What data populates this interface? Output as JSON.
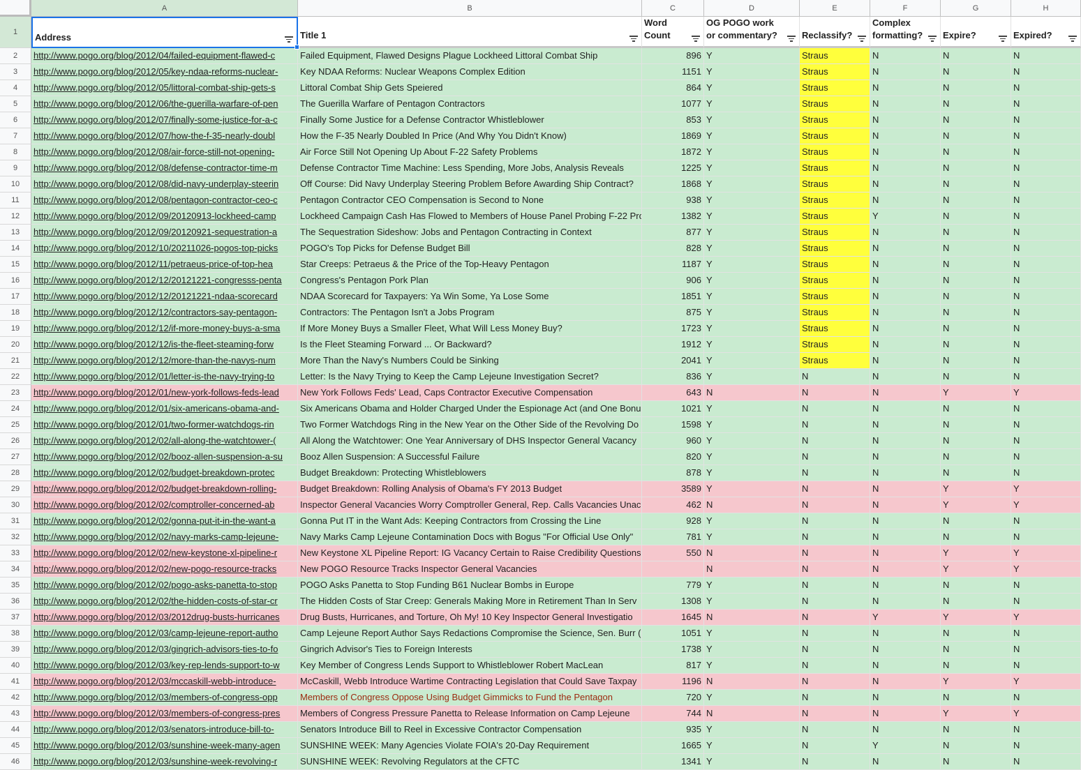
{
  "columns": [
    "A",
    "B",
    "C",
    "D",
    "E",
    "F",
    "G",
    "H"
  ],
  "headers": [
    "Address",
    "Title 1",
    "Word Count",
    "OG POGO work or commentary?",
    "Reclassify?",
    "Complex formatting?",
    "Expire?",
    "Expired?"
  ],
  "colors": {
    "green": "#c9ebd0",
    "pink": "#f6c7cd",
    "yellow": "#ffff3c",
    "dark_red_text": "#9c2a10"
  },
  "rows": [
    [
      "http://www.pogo.org/blog/2012/04/failed-equipment-flawed-c",
      "Failed Equipment, Flawed Designs Plague Lockheed Littoral Combat Ship",
      "896",
      "Y",
      "Straus",
      "N",
      "N",
      "N",
      "green"
    ],
    [
      "http://www.pogo.org/blog/2012/05/key-ndaa-reforms-nuclear-",
      "Key NDAA Reforms: Nuclear Weapons Complex Edition",
      "1151",
      "Y",
      "Straus",
      "N",
      "N",
      "N",
      "green"
    ],
    [
      "http://www.pogo.org/blog/2012/05/littoral-combat-ship-gets-s",
      "Littoral Combat Ship Gets Speiered",
      "864",
      "Y",
      "Straus",
      "N",
      "N",
      "N",
      "green"
    ],
    [
      "http://www.pogo.org/blog/2012/06/the-guerilla-warfare-of-pen",
      "The Guerilla Warfare of Pentagon Contractors",
      "1077",
      "Y",
      "Straus",
      "N",
      "N",
      "N",
      "green"
    ],
    [
      "http://www.pogo.org/blog/2012/07/finally-some-justice-for-a-c",
      "Finally Some Justice for a Defense Contractor Whistleblower",
      "853",
      "Y",
      "Straus",
      "N",
      "N",
      "N",
      "green"
    ],
    [
      "http://www.pogo.org/blog/2012/07/how-the-f-35-nearly-doubl",
      "How the F-35 Nearly Doubled In Price (And Why You Didn't Know)",
      "1869",
      "Y",
      "Straus",
      "N",
      "N",
      "N",
      "green"
    ],
    [
      "http://www.pogo.org/blog/2012/08/air-force-still-not-opening-",
      "Air Force Still Not Opening Up About F-22 Safety Problems",
      "1872",
      "Y",
      "Straus",
      "N",
      "N",
      "N",
      "green"
    ],
    [
      "http://www.pogo.org/blog/2012/08/defense-contractor-time-m",
      "Defense Contractor Time Machine: Less Spending, More Jobs, Analysis Reveals",
      "1225",
      "Y",
      "Straus",
      "N",
      "N",
      "N",
      "green"
    ],
    [
      "http://www.pogo.org/blog/2012/08/did-navy-underplay-steerin",
      "Off Course: Did Navy Underplay Steering Problem Before Awarding Ship Contract?",
      "1868",
      "Y",
      "Straus",
      "N",
      "N",
      "N",
      "green"
    ],
    [
      "http://www.pogo.org/blog/2012/08/pentagon-contractor-ceo-c",
      "Pentagon Contractor CEO Compensation is Second to None",
      "938",
      "Y",
      "Straus",
      "N",
      "N",
      "N",
      "green"
    ],
    [
      "http://www.pogo.org/blog/2012/09/20120913-lockheed-camp",
      "Lockheed Campaign Cash Has Flowed to Members of House Panel Probing F-22 Pro",
      "1382",
      "Y",
      "Straus",
      "Y",
      "N",
      "N",
      "green"
    ],
    [
      "http://www.pogo.org/blog/2012/09/20120921-sequestration-a",
      "The Sequestration Sideshow: Jobs and Pentagon Contracting in Context",
      "877",
      "Y",
      "Straus",
      "N",
      "N",
      "N",
      "green"
    ],
    [
      "http://www.pogo.org/blog/2012/10/20211026-pogos-top-picks",
      "POGO's Top Picks for Defense Budget Bill",
      "828",
      "Y",
      "Straus",
      "N",
      "N",
      "N",
      "green"
    ],
    [
      "http://www.pogo.org/blog/2012/11/petraeus-price-of-top-hea",
      "Star Creeps: Petraeus & the Price of the Top-Heavy Pentagon",
      "1187",
      "Y",
      "Straus",
      "N",
      "N",
      "N",
      "green"
    ],
    [
      "http://www.pogo.org/blog/2012/12/20121221-congresss-penta",
      "Congress's Pentagon Pork Plan",
      "906",
      "Y",
      "Straus",
      "N",
      "N",
      "N",
      "green"
    ],
    [
      "http://www.pogo.org/blog/2012/12/20121221-ndaa-scorecard",
      "NDAA Scorecard for Taxpayers: Ya Win Some, Ya Lose Some",
      "1851",
      "Y",
      "Straus",
      "N",
      "N",
      "N",
      "green"
    ],
    [
      "http://www.pogo.org/blog/2012/12/contractors-say-pentagon-",
      "Contractors: The Pentagon Isn't a Jobs Program",
      "875",
      "Y",
      "Straus",
      "N",
      "N",
      "N",
      "green"
    ],
    [
      "http://www.pogo.org/blog/2012/12/if-more-money-buys-a-sma",
      "If More Money Buys a Smaller Fleet, What Will Less Money Buy?",
      "1723",
      "Y",
      "Straus",
      "N",
      "N",
      "N",
      "green"
    ],
    [
      "http://www.pogo.org/blog/2012/12/is-the-fleet-steaming-forw",
      "Is the Fleet Steaming Forward ... Or Backward?",
      "1912",
      "Y",
      "Straus",
      "N",
      "N",
      "N",
      "green"
    ],
    [
      "http://www.pogo.org/blog/2012/12/more-than-the-navys-num",
      "More Than the Navy's Numbers Could be Sinking",
      "2041",
      "Y",
      "Straus",
      "N",
      "N",
      "N",
      "green"
    ],
    [
      "http://www.pogo.org/blog/2012/01/letter-is-the-navy-trying-to",
      "Letter: Is the Navy Trying to Keep the Camp Lejeune Investigation Secret?",
      "836",
      "Y",
      "N",
      "N",
      "N",
      "N",
      "green"
    ],
    [
      "http://www.pogo.org/blog/2012/01/new-york-follows-feds-lead",
      "New York Follows Feds' Lead, Caps Contractor Executive Compensation",
      "643",
      "N",
      "N",
      "N",
      "Y",
      "Y",
      "pink"
    ],
    [
      "http://www.pogo.org/blog/2012/01/six-americans-obama-and-",
      "Six Americans Obama and Holder Charged Under the Espionage Act (and One Bonu",
      "1021",
      "Y",
      "N",
      "N",
      "N",
      "N",
      "green"
    ],
    [
      "http://www.pogo.org/blog/2012/01/two-former-watchdogs-rin",
      "Two Former Watchdogs Ring in the New Year on the Other Side of the Revolving Do",
      "1598",
      "Y",
      "N",
      "N",
      "N",
      "N",
      "green"
    ],
    [
      "http://www.pogo.org/blog/2012/02/all-along-the-watchtower-(",
      "All Along the Watchtower: One Year Anniversary of DHS Inspector General Vacancy",
      "960",
      "Y",
      "N",
      "N",
      "N",
      "N",
      "green"
    ],
    [
      "http://www.pogo.org/blog/2012/02/booz-allen-suspension-a-su",
      "Booz Allen Suspension: A Successful Failure",
      "820",
      "Y",
      "N",
      "N",
      "N",
      "N",
      "green"
    ],
    [
      "http://www.pogo.org/blog/2012/02/budget-breakdown-protec",
      "Budget Breakdown: Protecting Whistleblowers",
      "878",
      "Y",
      "N",
      "N",
      "N",
      "N",
      "green"
    ],
    [
      "http://www.pogo.org/blog/2012/02/budget-breakdown-rolling-",
      "Budget Breakdown: Rolling Analysis of Obama's FY 2013 Budget",
      "3589",
      "Y",
      "N",
      "N",
      "Y",
      "Y",
      "pink"
    ],
    [
      "http://www.pogo.org/blog/2012/02/comptroller-concerned-ab",
      "Inspector General Vacancies Worry Comptroller General, Rep. Calls Vacancies Unac",
      "462",
      "N",
      "N",
      "N",
      "Y",
      "Y",
      "pink"
    ],
    [
      "http://www.pogo.org/blog/2012/02/gonna-put-it-in-the-want-a",
      "Gonna Put IT in the Want Ads: Keeping Contractors from Crossing the Line",
      "928",
      "Y",
      "N",
      "N",
      "N",
      "N",
      "green"
    ],
    [
      "http://www.pogo.org/blog/2012/02/navy-marks-camp-lejeune-",
      "Navy Marks Camp Lejeune Contamination Docs with Bogus \"For Official Use Only\"",
      "781",
      "Y",
      "N",
      "N",
      "N",
      "N",
      "green"
    ],
    [
      "http://www.pogo.org/blog/2012/02/new-keystone-xl-pipeline-r",
      "New Keystone XL Pipeline Report: IG Vacancy Certain to Raise Credibility Questions",
      "550",
      "N",
      "N",
      "N",
      "Y",
      "Y",
      "pink"
    ],
    [
      "http://www.pogo.org/blog/2012/02/new-pogo-resource-tracks",
      "New POGO Resource Tracks Inspector General Vacancies",
      "",
      "N",
      "N",
      "N",
      "Y",
      "Y",
      "pink"
    ],
    [
      "http://www.pogo.org/blog/2012/02/pogo-asks-panetta-to-stop",
      "POGO Asks Panetta to Stop Funding B61 Nuclear Bombs in Europe",
      "779",
      "Y",
      "N",
      "N",
      "N",
      "N",
      "green"
    ],
    [
      "http://www.pogo.org/blog/2012/02/the-hidden-costs-of-star-cr",
      "The Hidden Costs of Star Creep: Generals Making More in Retirement Than In Serv",
      "1308",
      "Y",
      "N",
      "N",
      "N",
      "N",
      "green"
    ],
    [
      "http://www.pogo.org/blog/2012/03/2012drug-busts-hurricanes",
      "Drug Busts, Hurricanes, and Torture, Oh My! 10 Key Inspector General Investigatio",
      "1645",
      "N",
      "N",
      "Y",
      "Y",
      "Y",
      "pink"
    ],
    [
      "http://www.pogo.org/blog/2012/03/camp-lejeune-report-autho",
      "Camp Lejeune Report Author Says Redactions Compromise the Science, Sen. Burr (",
      "1051",
      "Y",
      "N",
      "N",
      "N",
      "N",
      "green"
    ],
    [
      "http://www.pogo.org/blog/2012/03/gingrich-advisors-ties-to-fo",
      "Gingrich Advisor's Ties to Foreign Interests",
      "1738",
      "Y",
      "N",
      "N",
      "N",
      "N",
      "green"
    ],
    [
      "http://www.pogo.org/blog/2012/03/key-rep-lends-support-to-w",
      "Key Member of Congress Lends Support to Whistleblower Robert MacLean",
      "817",
      "Y",
      "N",
      "N",
      "N",
      "N",
      "green"
    ],
    [
      "http://www.pogo.org/blog/2012/03/mccaskill-webb-introduce-",
      "McCaskill, Webb Introduce Wartime Contracting Legislation that Could Save Taxpay",
      "1196",
      "N",
      "N",
      "N",
      "Y",
      "Y",
      "pink"
    ],
    [
      "http://www.pogo.org/blog/2012/03/members-of-congress-opp",
      "Members of Congress Oppose Using Budget Gimmicks to Fund the Pentagon",
      "720",
      "Y",
      "N",
      "N",
      "N",
      "N",
      "green-redtext"
    ],
    [
      "http://www.pogo.org/blog/2012/03/members-of-congress-pres",
      "Members of Congress Pressure Panetta to Release Information on Camp Lejeune",
      "744",
      "N",
      "N",
      "N",
      "Y",
      "Y",
      "pink"
    ],
    [
      "http://www.pogo.org/blog/2012/03/senators-introduce-bill-to-",
      "Senators Introduce Bill to Reel in Excessive Contractor Compensation",
      "935",
      "Y",
      "N",
      "N",
      "N",
      "N",
      "green"
    ],
    [
      "http://www.pogo.org/blog/2012/03/sunshine-week-many-agen",
      "SUNSHINE WEEK: Many Agencies Violate FOIA's 20-Day Requirement",
      "1665",
      "Y",
      "N",
      "Y",
      "N",
      "N",
      "green"
    ],
    [
      "http://www.pogo.org/blog/2012/03/sunshine-week-revolving-r",
      "SUNSHINE WEEK: Revolving Regulators at the CFTC",
      "1341",
      "Y",
      "N",
      "N",
      "N",
      "N",
      "green"
    ]
  ]
}
